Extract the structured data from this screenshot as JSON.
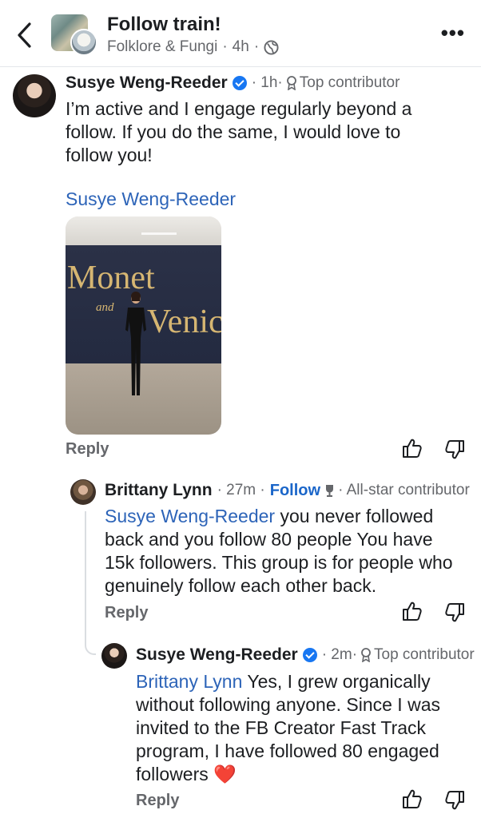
{
  "header": {
    "title": "Follow train!",
    "group_name": "Folklore & Fungi",
    "time": "4h",
    "separator": "·"
  },
  "comments": [
    {
      "author": "Susye Weng-Reeder",
      "time": "· 1h·",
      "badge": "Top contributor",
      "text": "I’m active and I engage regularly beyond a follow. If you do the same, I would love to follow you!",
      "link_name": "Susye Weng-Reeder",
      "photo": {
        "line1": "Monet",
        "line2": "and",
        "line3": "Venice"
      },
      "reply_label": "Reply"
    },
    {
      "author": "Brittany Lynn",
      "time": "· 27m ·",
      "follow_label": "Follow",
      "badge": "· All-star contributor",
      "mention": "Susye Weng-Reeder",
      "text": " you never followed back and you follow 80 people You have 15k followers. This group is for people who genuinely follow each other back.",
      "reply_label": "Reply"
    },
    {
      "author": "Susye Weng-Reeder",
      "time": "· 2m·",
      "badge": "Top contributor",
      "mention": "Brittany Lynn",
      "text": " Yes, I grew organically without following anyone. Since I was invited to the FB Creator Fast Track program, I have followed 80 engaged followers ",
      "emoji": "❤️",
      "reply_label": "Reply"
    }
  ],
  "icons": {
    "back": "chevron-left-icon",
    "more": "more-icon",
    "globe": "globe-icon",
    "badge": "award-icon",
    "like": "thumbs-up-icon",
    "dislike": "thumbs-down-icon"
  },
  "colors": {
    "link": "#2d64b8",
    "verified": "#1877f2",
    "meta": "#65676b"
  }
}
